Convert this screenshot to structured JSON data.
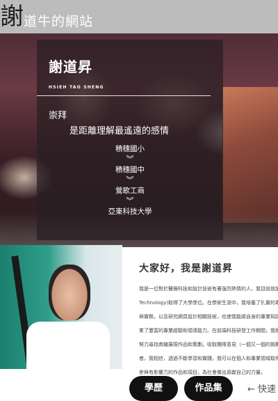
{
  "header": {
    "logo_char": "謝",
    "site_title": "道牛的網站"
  },
  "hero": {
    "name": "謝道昇",
    "name_en": "HSIEH TAO SHENG",
    "admire_label": "崇拜",
    "quote": "是距離理解最遙遠的感情",
    "timeline": [
      "積穗國小",
      "積穗國中",
      "鶯歌工商",
      "亞東科技大學"
    ]
  },
  "intro": {
    "title": "大家好，我是謝道昇",
    "lines": [
      "我是一位對於醫療科技和設計技術有著強烈熱情的人，我目前就讀於亞東科技大學",
      "Technology)取得了大學學位。在學術生涯中，我培養了扎實的專業知識和實作能力",
      "與實務，以及研究網頁設計相關技術，也使我能將自身的專業知識融入設計之中，",
      "累了豐富的專業經驗和領導能力。在前端科技研發工作期間，我積極參與專案並",
      "努力尋找商機展現作品和策劃。吸取團隊意見（一個又一個的挑戰中學習成長",
      "者，我相信，透過不斷學習和實踐，我可以在個人和專業領域取得更大的成功，",
      "參與有影響力的作品和項目，為社會做出貢獻自己的力量。"
    ]
  },
  "buttons": {
    "education": "學歷",
    "portfolio": "作品集",
    "quick": "← 快速"
  }
}
